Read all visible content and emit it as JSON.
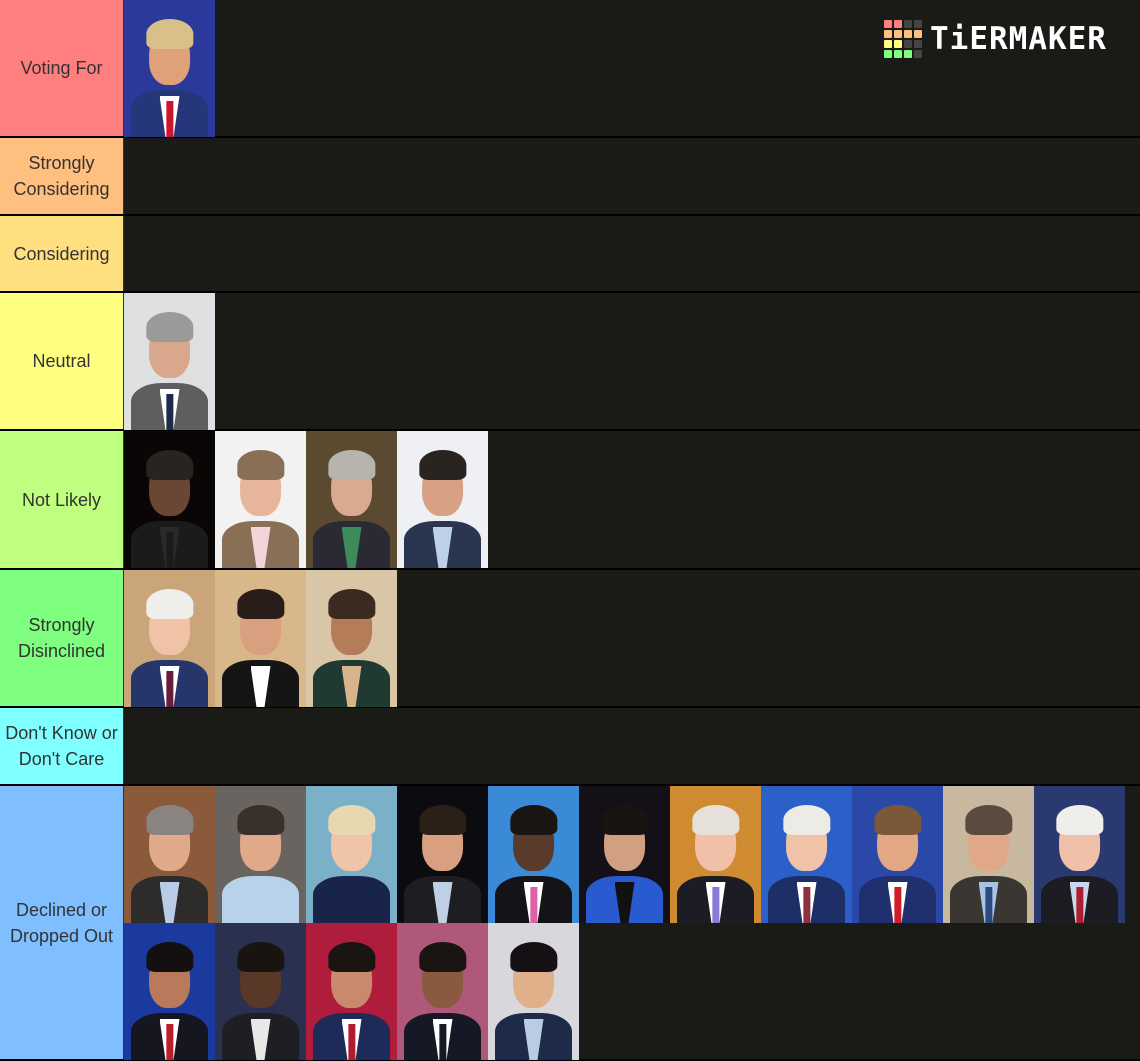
{
  "app": {
    "title": "TierMaker",
    "logo_text": "TiERMAKER"
  },
  "logo_grid_colors": [
    "#ff7f7f",
    "#ff7f7f",
    "#444444",
    "#444444",
    "#ffbf7f",
    "#ffbf7f",
    "#ffbf7f",
    "#ffbf7f",
    "#ffff7f",
    "#ffff7f",
    "#444444",
    "#444444",
    "#7fff7f",
    "#7fff7f",
    "#7fff7f",
    "#444444"
  ],
  "tiers": [
    {
      "label": "Voting For",
      "color": "#ff7f7f",
      "items": [
        {
          "desc": "candidate-photo",
          "bg": "#2b3a9a",
          "hair": "#d9c08a",
          "skin": "#e0a079",
          "suit": "#26367a",
          "shirt": "#ffffff",
          "tie": "#d0142b"
        }
      ]
    },
    {
      "label": "Strongly Considering",
      "color": "#ffbf7f",
      "items": []
    },
    {
      "label": "Considering",
      "color": "#ffdf7f",
      "items": []
    },
    {
      "label": "Neutral",
      "color": "#ffff7f",
      "items": [
        {
          "desc": "candidate-photo",
          "bg": "#dfe0e2",
          "hair": "#9a9a98",
          "skin": "#d9a78c",
          "suit": "#5e5e60",
          "shirt": "#ffffff",
          "tie": "#1e2a4a"
        }
      ]
    },
    {
      "label": "Not Likely",
      "color": "#bfff7f",
      "items": [
        {
          "desc": "candidate-photo",
          "bg": "#0a0606",
          "hair": "#2a2420",
          "skin": "#6b4634",
          "suit": "#1b1b1b",
          "shirt": "#2a2a2a",
          "tie": "#1b1b1b"
        },
        {
          "desc": "candidate-photo",
          "bg": "#f2f2f2",
          "hair": "#8a6f57",
          "skin": "#e6b59a",
          "suit": "#8a6f57",
          "shirt": "#f4d4d8",
          "tie": "#f4d4d8"
        },
        {
          "desc": "candidate-photo",
          "bg": "#5a4a30",
          "hair": "#b7b4ad",
          "skin": "#d9aa90",
          "suit": "#2a2a34",
          "shirt": "#3d8a5a",
          "tie": "#3d8a5a"
        },
        {
          "desc": "candidate-photo",
          "bg": "#eef0f4",
          "hair": "#2a2420",
          "skin": "#d8a184",
          "suit": "#2a3550",
          "shirt": "#bcd0ea",
          "tie": "#bcd0ea"
        }
      ]
    },
    {
      "label": "Strongly Disinclined",
      "color": "#7fff7f",
      "items": [
        {
          "desc": "candidate-photo",
          "bg": "#caa57a",
          "hair": "#efeeea",
          "skin": "#f0c2a6",
          "suit": "#26366a",
          "shirt": "#ffffff",
          "tie": "#6a1a3a"
        },
        {
          "desc": "candidate-photo",
          "bg": "#d8b78a",
          "hair": "#2a1c18",
          "skin": "#d8a07e",
          "suit": "#151515",
          "shirt": "#ffffff",
          "tie": "#ffffff"
        },
        {
          "desc": "candidate-photo",
          "bg": "#d9c6a6",
          "hair": "#3a2a20",
          "skin": "#b57c5a",
          "suit": "#1f3a30",
          "shirt": "#d8b48a",
          "tie": "#d8b48a"
        }
      ]
    },
    {
      "label": "Don't Know or Don't Care",
      "color": "#7fffff",
      "items": []
    },
    {
      "label": "Declined or Dropped Out",
      "color": "#7fbfff",
      "items": [
        {
          "desc": "candidate-photo",
          "bg": "#8a5a3a",
          "hair": "#8a8480",
          "skin": "#e0aa8a",
          "suit": "#2e2c2a",
          "shirt": "#b8cce8",
          "tie": "#b8cce8"
        },
        {
          "desc": "candidate-photo",
          "bg": "#6a6460",
          "hair": "#3a302a",
          "skin": "#e0aa8a",
          "suit": "#b8d2ec",
          "shirt": "#b8d2ec",
          "tie": "#b8d2ec"
        },
        {
          "desc": "candidate-photo",
          "bg": "#7ab0c8",
          "hair": "#e8d8b0",
          "skin": "#f0c4a8",
          "suit": "#18244a",
          "shirt": "#18244a",
          "tie": "#18244a"
        },
        {
          "desc": "candidate-photo",
          "bg": "#0c0c10",
          "hair": "#2a2018",
          "skin": "#d8a080",
          "suit": "#1e1e22",
          "shirt": "#c0d0e4",
          "tie": "#c0d0e4"
        },
        {
          "desc": "candidate-photo",
          "bg": "#3a8ad8",
          "hair": "#1a1412",
          "skin": "#5a3a2a",
          "suit": "#141418",
          "shirt": "#ffffff",
          "tie": "#e060a8"
        },
        {
          "desc": "candidate-photo",
          "bg": "#141018",
          "hair": "#1a1410",
          "skin": "#d0a080",
          "suit": "#2a5ad0",
          "shirt": "#111111",
          "tie": "#111111"
        },
        {
          "desc": "candidate-photo",
          "bg": "#d08a30",
          "hair": "#e6e0da",
          "skin": "#f0c0a8",
          "suit": "#1c1c24",
          "shirt": "#ffffff",
          "tie": "#8a7ad8"
        },
        {
          "desc": "candidate-photo",
          "bg": "#2a60c8",
          "hair": "#ecebe6",
          "skin": "#f0c2a8",
          "suit": "#1e2e66",
          "shirt": "#ffffff",
          "tie": "#8a3040"
        },
        {
          "desc": "candidate-photo",
          "bg": "#2a48a8",
          "hair": "#7a5838",
          "skin": "#e2a886",
          "suit": "#20306e",
          "shirt": "#ffffff",
          "tie": "#d01c28"
        },
        {
          "desc": "candidate-photo",
          "bg": "#c8b8a0",
          "hair": "#5a4a40",
          "skin": "#e0a888",
          "suit": "#3a3632",
          "shirt": "#a8c4e4",
          "tie": "#2a4a80"
        },
        {
          "desc": "candidate-photo",
          "bg": "#2a3a70",
          "hair": "#f0eeea",
          "skin": "#f0c0a8",
          "suit": "#1c1c22",
          "shirt": "#c8d8ec",
          "tie": "#b01c30"
        },
        {
          "desc": "candidate-photo",
          "bg": "#1a3aa0",
          "hair": "#141010",
          "skin": "#b87a5a",
          "suit": "#161620",
          "shirt": "#ffffff",
          "tie": "#c01c28"
        },
        {
          "desc": "candidate-photo",
          "bg": "#2a3050",
          "hair": "#1a1410",
          "skin": "#5a3828",
          "suit": "#1e1e24",
          "shirt": "#e8e8e8",
          "tie": "#e8e8e8"
        },
        {
          "desc": "candidate-photo",
          "bg": "#b01c3c",
          "hair": "#1a1412",
          "skin": "#c88a6a",
          "suit": "#1e2a5a",
          "shirt": "#ffffff",
          "tie": "#b01c30"
        },
        {
          "desc": "candidate-photo",
          "bg": "#b0587a",
          "hair": "#1a1412",
          "skin": "#8a5a40",
          "suit": "#161826",
          "shirt": "#ffffff",
          "tie": "#161826"
        },
        {
          "desc": "candidate-photo",
          "bg": "#d8d8dc",
          "hair": "#141014",
          "skin": "#e0b08a",
          "suit": "#1e2a4a",
          "shirt": "#b8cce4",
          "tie": "#b8cce4"
        }
      ]
    }
  ]
}
